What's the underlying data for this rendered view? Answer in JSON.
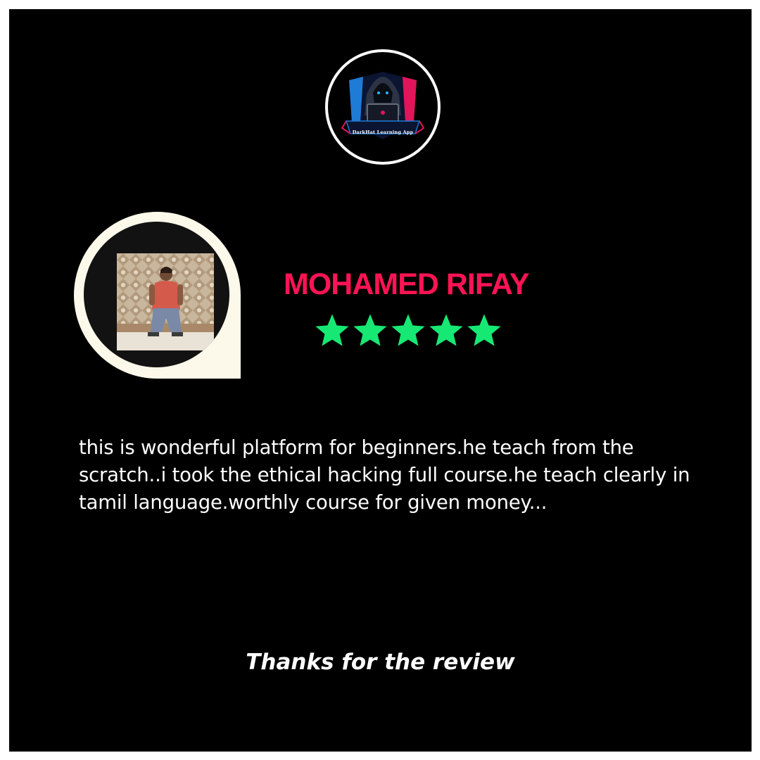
{
  "logo": {
    "text": "DarkHat Learning App",
    "icon": "hooded-hacker-laptop-shield-icon"
  },
  "reviewer": {
    "name": "MOHAMED RIFAY",
    "avatar_icon": "reviewer-photo"
  },
  "rating": {
    "value": 5,
    "max": 5,
    "icon": "star-icon",
    "color": "#17e873"
  },
  "review": {
    "text": "this is wonderful platform for beginners.he teach from the scratch..i took the ethical hacking full course.he teach clearly in tamil language.worthly course for given money..."
  },
  "footer": {
    "thanks": "Thanks for the review"
  },
  "colors": {
    "background": "#000000",
    "frame": "#ffffff",
    "accent_name": "#fd1454",
    "bubble": "#fcf9ea"
  }
}
